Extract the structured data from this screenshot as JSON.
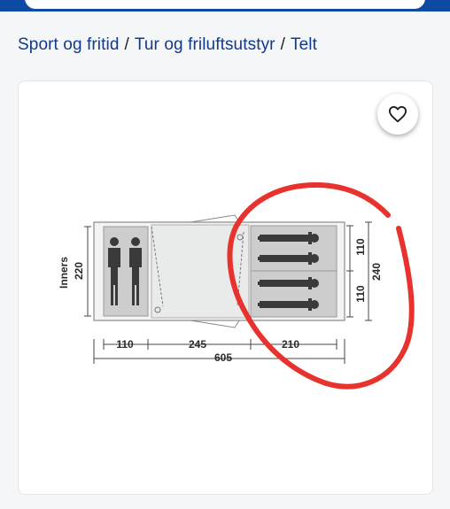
{
  "breadcrumb": {
    "items": [
      "Sport og fritid",
      "Tur og friluftsutstyr",
      "Telt"
    ],
    "separator": "/"
  },
  "favorite": {
    "icon": "heart-icon"
  },
  "floor_plan": {
    "inner_label": "Inners",
    "inner_height": "220",
    "right_half_top": "110",
    "right_half_bottom": "110",
    "right_total": "240",
    "bottom_segments": [
      "110",
      "245",
      "210"
    ],
    "bottom_total": "605"
  },
  "annotation": {
    "color": "#e8322d",
    "shape": "hand-drawn circle"
  },
  "colors": {
    "brand_blue": "#0d4aa3",
    "link": "#123a8a"
  }
}
